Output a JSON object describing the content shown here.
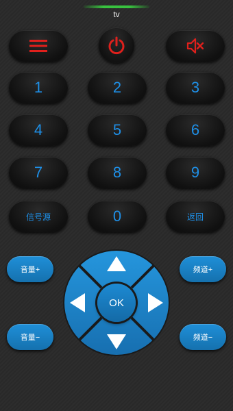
{
  "app": {
    "title": "tv"
  },
  "row1": {
    "menu_icon": "menu-icon",
    "power_icon": "power-icon",
    "mute_icon": "mute-icon"
  },
  "digits": [
    "1",
    "2",
    "3",
    "4",
    "5",
    "6",
    "7",
    "8",
    "9"
  ],
  "row5": {
    "source_label": "信号源",
    "zero_label": "0",
    "back_label": "返回"
  },
  "dpad": {
    "ok_label": "OK"
  },
  "side": {
    "vol_up_label": "音量+",
    "vol_down_label": "音量−",
    "ch_up_label": "频道+",
    "ch_down_label": "频道−"
  },
  "colors": {
    "accent_blue": "#1e90e8",
    "icon_red": "#e0201c",
    "indicator_green": "#39c23f",
    "background": "#2a2a2a"
  }
}
